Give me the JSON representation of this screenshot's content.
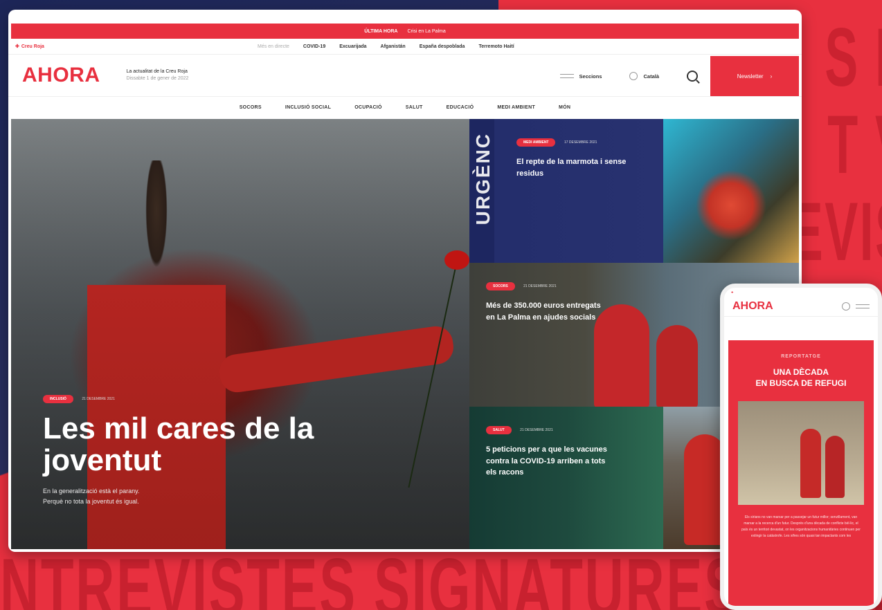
{
  "topbar": {
    "left": "ÚLTIMA HORA",
    "right": "Crisi en La Palma"
  },
  "util": {
    "logo": "Creu Roja",
    "links": [
      "Més en directe",
      "COVID-19",
      "Excuarijada",
      "Afganistán",
      "España despoblada",
      "Terremoto Haití"
    ]
  },
  "header": {
    "brand": "AHORA",
    "tagline": "La actualitat de la Creu Roja",
    "date": "Dissabte 1 de gener de 2022",
    "sections": "Seccions",
    "language": "Català",
    "newsletter": "Newsletter"
  },
  "nav": [
    "SOCORS",
    "INCLUSIÓ SOCIAL",
    "OCUPACIÓ",
    "SALUT",
    "EDUCACIÓ",
    "MEDI AMBIENT",
    "MÓN"
  ],
  "hero": {
    "tag": "INCLUSIÓ",
    "date": "21 DESEMBRE 2021",
    "title": "Les mil cares de la joventut",
    "lead1": "En la generalització està el parany.",
    "lead2": "Perquè no tota la joventut és igual."
  },
  "cards": [
    {
      "tag": "MEDI AMBIENT",
      "date": "17 DESEMBRE 2021",
      "title": "El repte de la marmota i sense residus",
      "banner": "URGÈNC"
    },
    {
      "tag": "SOCORS",
      "date": "21 DESEMBRE 2021",
      "title": "Més de 350.000 euros entregats en La Palma en ajudes socials"
    },
    {
      "tag": "SALUT",
      "date": "21 DESEMBRE 2021",
      "title": "5 peticions per a que les vacunes contra la COVID-19 arriben a tots els racons"
    }
  ],
  "mobile": {
    "brand": "AHORA",
    "kicker": "REPORTATGE",
    "title1": "UNA DÈCADA",
    "title2": "EN BUSCA DE REFUGI",
    "text": "Els sirians no van marxar per a passejar un futur millor; senzillament, van marxar a la recerca d'un futur. Després d'una dècada de conflicte bèl·lic, el país és un territori devastat, on les organitzacions humanitàries continuen per extingir la catàstrofe. Les xifres són quasi tan impactants com les"
  },
  "background": {
    "bottom_words": "NTREVISTES SIGNATURES ESTUDIS",
    "right_words": "S P\nT V\nEVIS"
  },
  "colors": {
    "brand": "#e8303f",
    "navy": "#232d6b"
  }
}
